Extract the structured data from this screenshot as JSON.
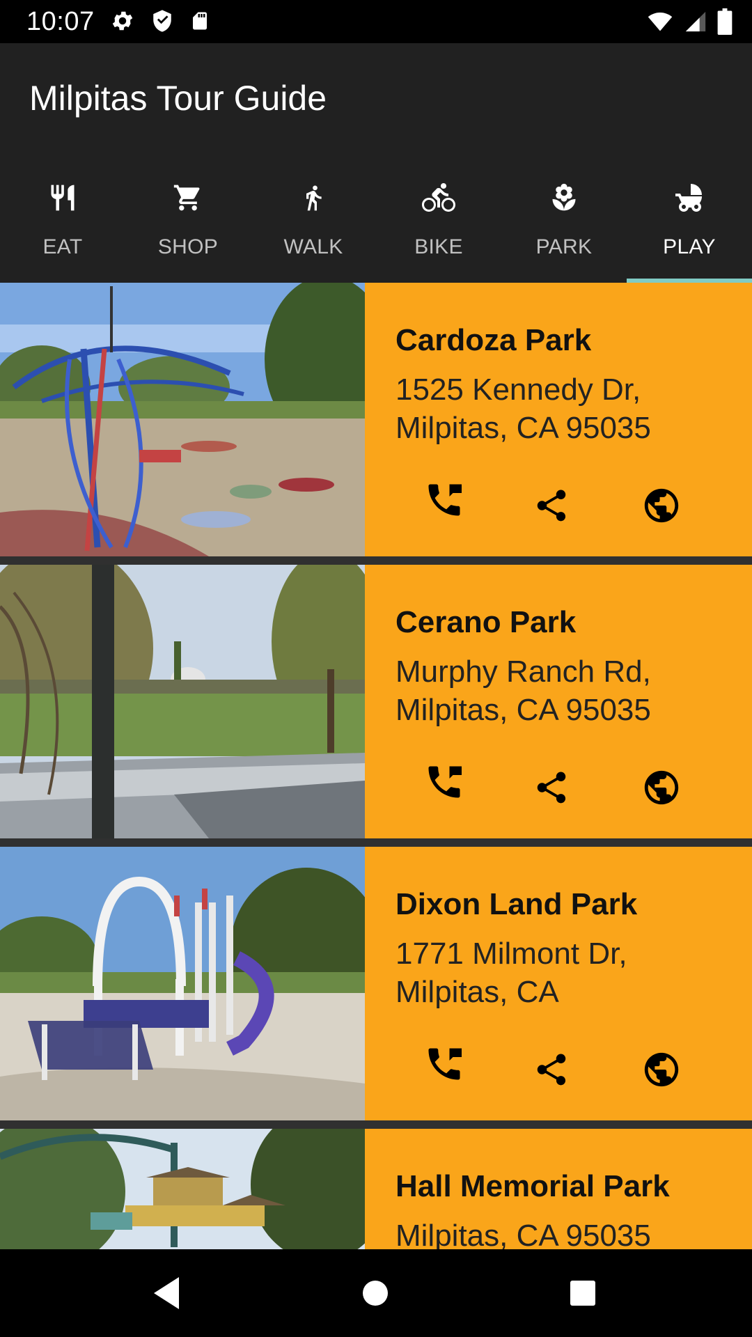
{
  "status_bar": {
    "time": "10:07",
    "left_icons": [
      "settings-icon",
      "shield-icon",
      "sd-card-icon"
    ],
    "right_icons": [
      "wifi-icon",
      "cell-signal-icon",
      "battery-icon"
    ]
  },
  "app_bar": {
    "title": "Milpitas Tour Guide"
  },
  "tabs": [
    {
      "label": "EAT",
      "icon": "restaurant-icon"
    },
    {
      "label": "SHOP",
      "icon": "shopping-cart-icon"
    },
    {
      "label": "WALK",
      "icon": "walk-icon"
    },
    {
      "label": "BIKE",
      "icon": "bike-icon"
    },
    {
      "label": "PARK",
      "icon": "local-florist-icon"
    },
    {
      "label": "PLAY",
      "icon": "stroller-icon"
    }
  ],
  "active_tab": "PLAY",
  "colors": {
    "card_background": "#FAA51A",
    "app_bar": "#212121",
    "tab_indicator": "#80CBC4",
    "list_background": "#303030"
  },
  "places": [
    {
      "name": "Cardoza Park",
      "address": "1525 Kennedy Dr, Milpitas, CA 95035",
      "photo": "playground with blue and red climbing structure"
    },
    {
      "name": "Cerano Park",
      "address": "Murphy Ranch Rd, Milpitas, CA 95035",
      "photo": "grassy park field with trees"
    },
    {
      "name": "Dixon Land Park",
      "address": "1771 Milmont Dr, Milpitas, CA",
      "photo": "white playground with purple slide"
    },
    {
      "name": "Hall Memorial Park",
      "address": "Milpitas, CA 95035",
      "photo": "playground with gazebo roofs"
    }
  ],
  "card_actions": [
    "phone-icon",
    "share-icon",
    "web-icon"
  ],
  "nav_bar": [
    "back-icon",
    "home-icon",
    "recents-icon"
  ]
}
